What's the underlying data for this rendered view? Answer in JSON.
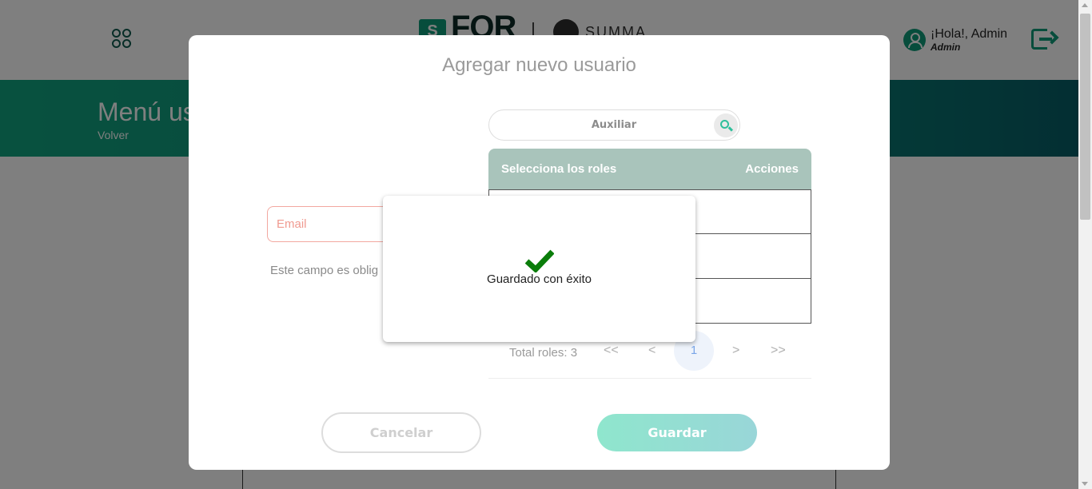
{
  "header": {
    "brand_s": "S",
    "brand_for": "FOR",
    "brand_summa": "SUMMA",
    "greeting": "¡Hola!, Admin",
    "role": "Admin"
  },
  "band": {
    "title": "Menú us",
    "back": "Volver"
  },
  "modal": {
    "title": "Agregar nuevo usuario",
    "email_placeholder": "Email",
    "email_error": "Este campo es oblig",
    "search_placeholder": "Auxiliar",
    "table": {
      "col_roles": "Selecciona los roles",
      "col_actions": "Acciones",
      "rows": [
        "",
        "",
        ""
      ]
    },
    "pagination": {
      "total": "Total roles: 3",
      "first": "<<",
      "prev": "<",
      "current": "1",
      "next": ">",
      "last": ">>"
    },
    "cancel_label": "Cancelar",
    "save_label": "Guardar"
  },
  "toast": {
    "message": "Guardado con éxito",
    "icon": "check-icon"
  },
  "colors": {
    "accent": "#0e9a78",
    "table_head": "#a9c4bb",
    "check": "#0a7d0a",
    "error_border": "#f2a8a0"
  }
}
